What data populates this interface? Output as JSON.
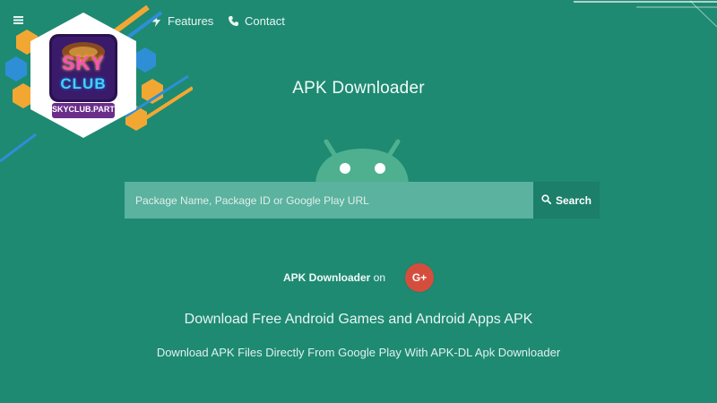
{
  "nav": {
    "items": [
      {
        "label": "Features",
        "icon": "bolt-icon"
      },
      {
        "label": "Contact",
        "icon": "phone-icon"
      }
    ],
    "menu_icon": "hamburger-icon"
  },
  "logo": {
    "text_top": "SKY",
    "text_mid": "CLUB",
    "text_domain": "SKYCLUB.PARTY"
  },
  "page": {
    "title": "APK Downloader"
  },
  "search": {
    "placeholder": "Package Name, Package ID or Google Play URL",
    "button_label": "Search"
  },
  "social": {
    "label_bold": "APK Downloader",
    "label_rest": " on",
    "badge": "G+"
  },
  "content": {
    "headline": "Download Free Android Games and Android Apps APK",
    "subline": "Download APK Files Directly From Google Play With APK-DL Apk Downloader"
  },
  "colors": {
    "background": "#1e8a72",
    "android": "#4fb08f",
    "search_input": "#5ab29f",
    "search_button": "#1b7f69",
    "gplus": "#d54e3d"
  }
}
